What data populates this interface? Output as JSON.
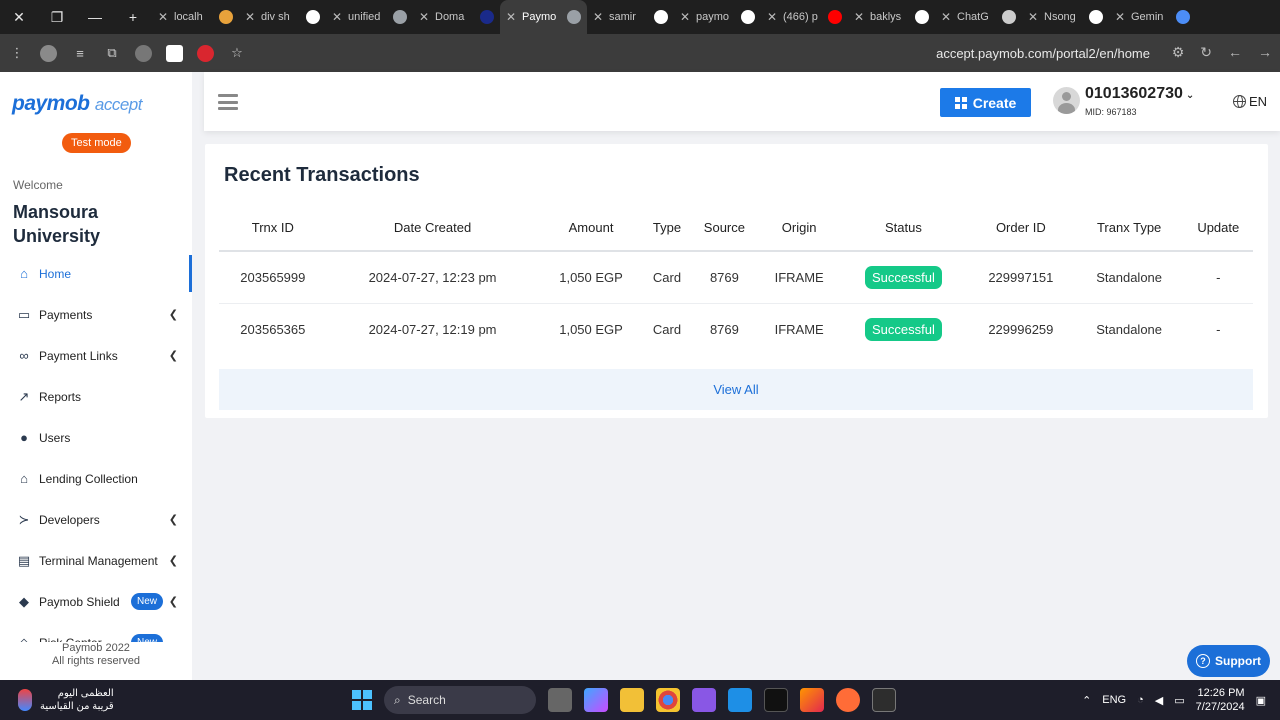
{
  "browser": {
    "tabs": [
      {
        "label": "localh",
        "fav": "#e8a23b"
      },
      {
        "label": "div sh",
        "fav": "#ffffff"
      },
      {
        "label": "unified",
        "fav": "#9aa0a6"
      },
      {
        "label": "Doma",
        "fav": "#1a2a8a"
      },
      {
        "label": "Paymo",
        "fav": "#9aa0a6"
      },
      {
        "label": "samir",
        "fav": "#ffffff"
      },
      {
        "label": "paymo",
        "fav": "#ffffff"
      },
      {
        "label": "(466) p",
        "fav": "#ff0000"
      },
      {
        "label": "baklys",
        "fav": "#ffffff"
      },
      {
        "label": "ChatG",
        "fav": "#cccccc"
      },
      {
        "label": "Nsong",
        "fav": "#ffffff"
      },
      {
        "label": "Gemin",
        "fav": "#4c8df6"
      }
    ],
    "url": "accept.paymob.com/portal2/en/home"
  },
  "sidebar": {
    "logo_main": "paymob",
    "logo_sub": "accept",
    "test_mode": "Test mode",
    "welcome": "Welcome",
    "org_name": "Mansoura University",
    "items": [
      {
        "label": "Home",
        "icon": "home-icon",
        "glyph": "⌂",
        "chevron": false,
        "badge": ""
      },
      {
        "label": "Payments",
        "icon": "card-icon",
        "glyph": "▭",
        "chevron": true,
        "badge": ""
      },
      {
        "label": "Payment Links",
        "icon": "link-icon",
        "glyph": "∞",
        "chevron": true,
        "badge": ""
      },
      {
        "label": "Reports",
        "icon": "chart-icon",
        "glyph": "↗",
        "chevron": false,
        "badge": ""
      },
      {
        "label": "Users",
        "icon": "user-icon",
        "glyph": "●",
        "chevron": false,
        "badge": ""
      },
      {
        "label": "Lending Collection",
        "icon": "collection-icon",
        "glyph": "⌂",
        "chevron": false,
        "badge": ""
      },
      {
        "label": "Developers",
        "icon": "terminal-icon",
        "glyph": "≻",
        "chevron": true,
        "badge": ""
      },
      {
        "label": "Terminal Management",
        "icon": "pos-icon",
        "glyph": "▤",
        "chevron": true,
        "badge": ""
      },
      {
        "label": "Paymob Shield",
        "icon": "shield-icon",
        "glyph": "◆",
        "chevron": true,
        "badge": "New"
      },
      {
        "label": "Risk Center",
        "icon": "risk-icon",
        "glyph": "◇",
        "chevron": false,
        "badge": "New"
      }
    ],
    "copyright_1": "Paymob 2022",
    "copyright_2": "All rights reserved"
  },
  "header": {
    "create_label": "Create",
    "phone": "01013602730",
    "mid": "MID: 967183",
    "lang": "EN"
  },
  "transactions": {
    "title": "Recent Transactions",
    "columns": [
      "Trnx ID",
      "Date Created",
      "Amount",
      "Type",
      "Source",
      "Origin",
      "Status",
      "Order ID",
      "Tranx Type",
      "Update"
    ],
    "rows": [
      [
        "203565999",
        "2024-07-27, 12:23 pm",
        "1,050 EGP",
        "Card",
        "8769",
        "IFRAME",
        "Successful",
        "229997151",
        "Standalone",
        "-"
      ],
      [
        "203565365",
        "2024-07-27, 12:19 pm",
        "1,050 EGP",
        "Card",
        "8769",
        "IFRAME",
        "Successful",
        "229996259",
        "Standalone",
        "-"
      ]
    ],
    "view_all": "View All"
  },
  "support_label": "Support",
  "taskbar": {
    "weather_line1": "العظمى اليوم",
    "weather_line2": "قريبة من القياسية",
    "search": "Search",
    "lang": "ENG",
    "time": "12:26 PM",
    "date": "7/27/2024"
  },
  "colors": {
    "brand": "#1c6fd8",
    "test_mode": "#f25c0f",
    "success": "#15c988"
  }
}
